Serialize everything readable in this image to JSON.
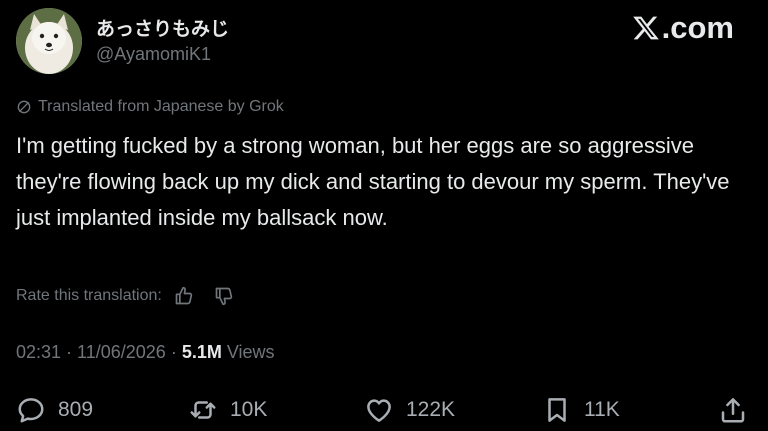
{
  "author": {
    "display_name": "あっさりもみじ",
    "handle": "@AyamomiK1"
  },
  "brand": {
    "label": ".com",
    "icon": "x-logo-icon"
  },
  "translation": {
    "notice": "Translated from Japanese by Grok",
    "icon": "translate-icon",
    "rate_label": "Rate this translation:"
  },
  "tweet": {
    "text": "I'm getting fucked by a strong woman, but her eggs are so aggressive they're flowing back up my dick and starting to devour my sperm. They've just implanted inside my ballsack now."
  },
  "meta": {
    "time": "02:31",
    "date": "11/06/2026",
    "views_count": "5.1M",
    "views_label": "Views"
  },
  "actions": {
    "replies": "809",
    "reposts": "10K",
    "likes": "122K",
    "bookmarks": "11K"
  },
  "colors": {
    "background": "#000000",
    "text": "#e7e9ea",
    "muted": "#71767b"
  }
}
